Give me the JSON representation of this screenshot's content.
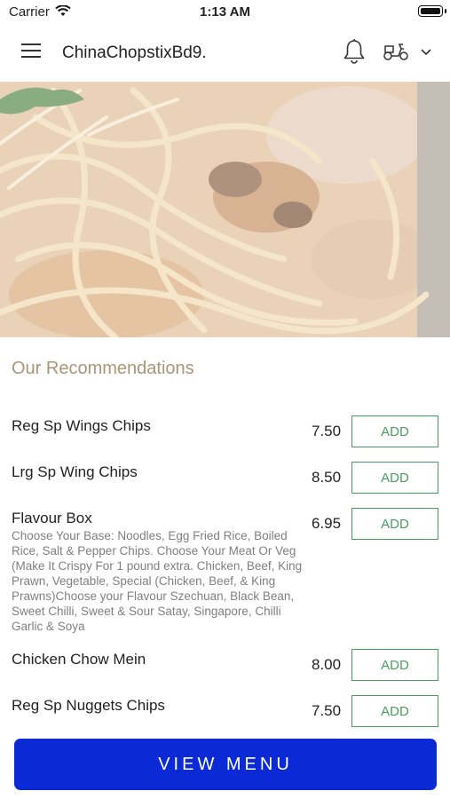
{
  "status_bar": {
    "carrier": "Carrier",
    "time": "1:13 AM"
  },
  "header": {
    "title": "ChinaChopstixBd9."
  },
  "hero": {
    "image": "noodles-dish-photo"
  },
  "recommendations": {
    "title": "Our Recommendations",
    "items": [
      {
        "name": "Reg Sp Wings Chips",
        "description": "",
        "price": "7.50",
        "add_label": "ADD"
      },
      {
        "name": "Lrg Sp Wing Chips",
        "description": "",
        "price": "8.50",
        "add_label": "ADD"
      },
      {
        "name": "Flavour Box",
        "description": "Choose Your Base: Noodles, Egg Fried Rice, Boiled Rice, Salt & Pepper Chips. Choose Your Meat Or Veg (Make It Crispy For 1 pound extra. Chicken, Beef, King Prawn, Vegetable, Special (Chicken, Beef, & King Prawns)Choose your Flavour Szechuan, Black Bean, Sweet Chilli, Sweet & Sour Satay, Singapore, Chilli Garlic & Soya",
        "price": "6.95",
        "add_label": "ADD"
      },
      {
        "name": "Chicken Chow Mein",
        "description": "",
        "price": "8.00",
        "add_label": "ADD"
      },
      {
        "name": "Reg Sp Nuggets Chips",
        "description": "",
        "price": "7.50",
        "add_label": "ADD"
      }
    ]
  },
  "footer": {
    "view_menu_label": "VIEW MENU"
  },
  "colors": {
    "accent_green": "#4b9b63",
    "primary_blue": "#0b2ad6",
    "section_title": "#a99679"
  }
}
